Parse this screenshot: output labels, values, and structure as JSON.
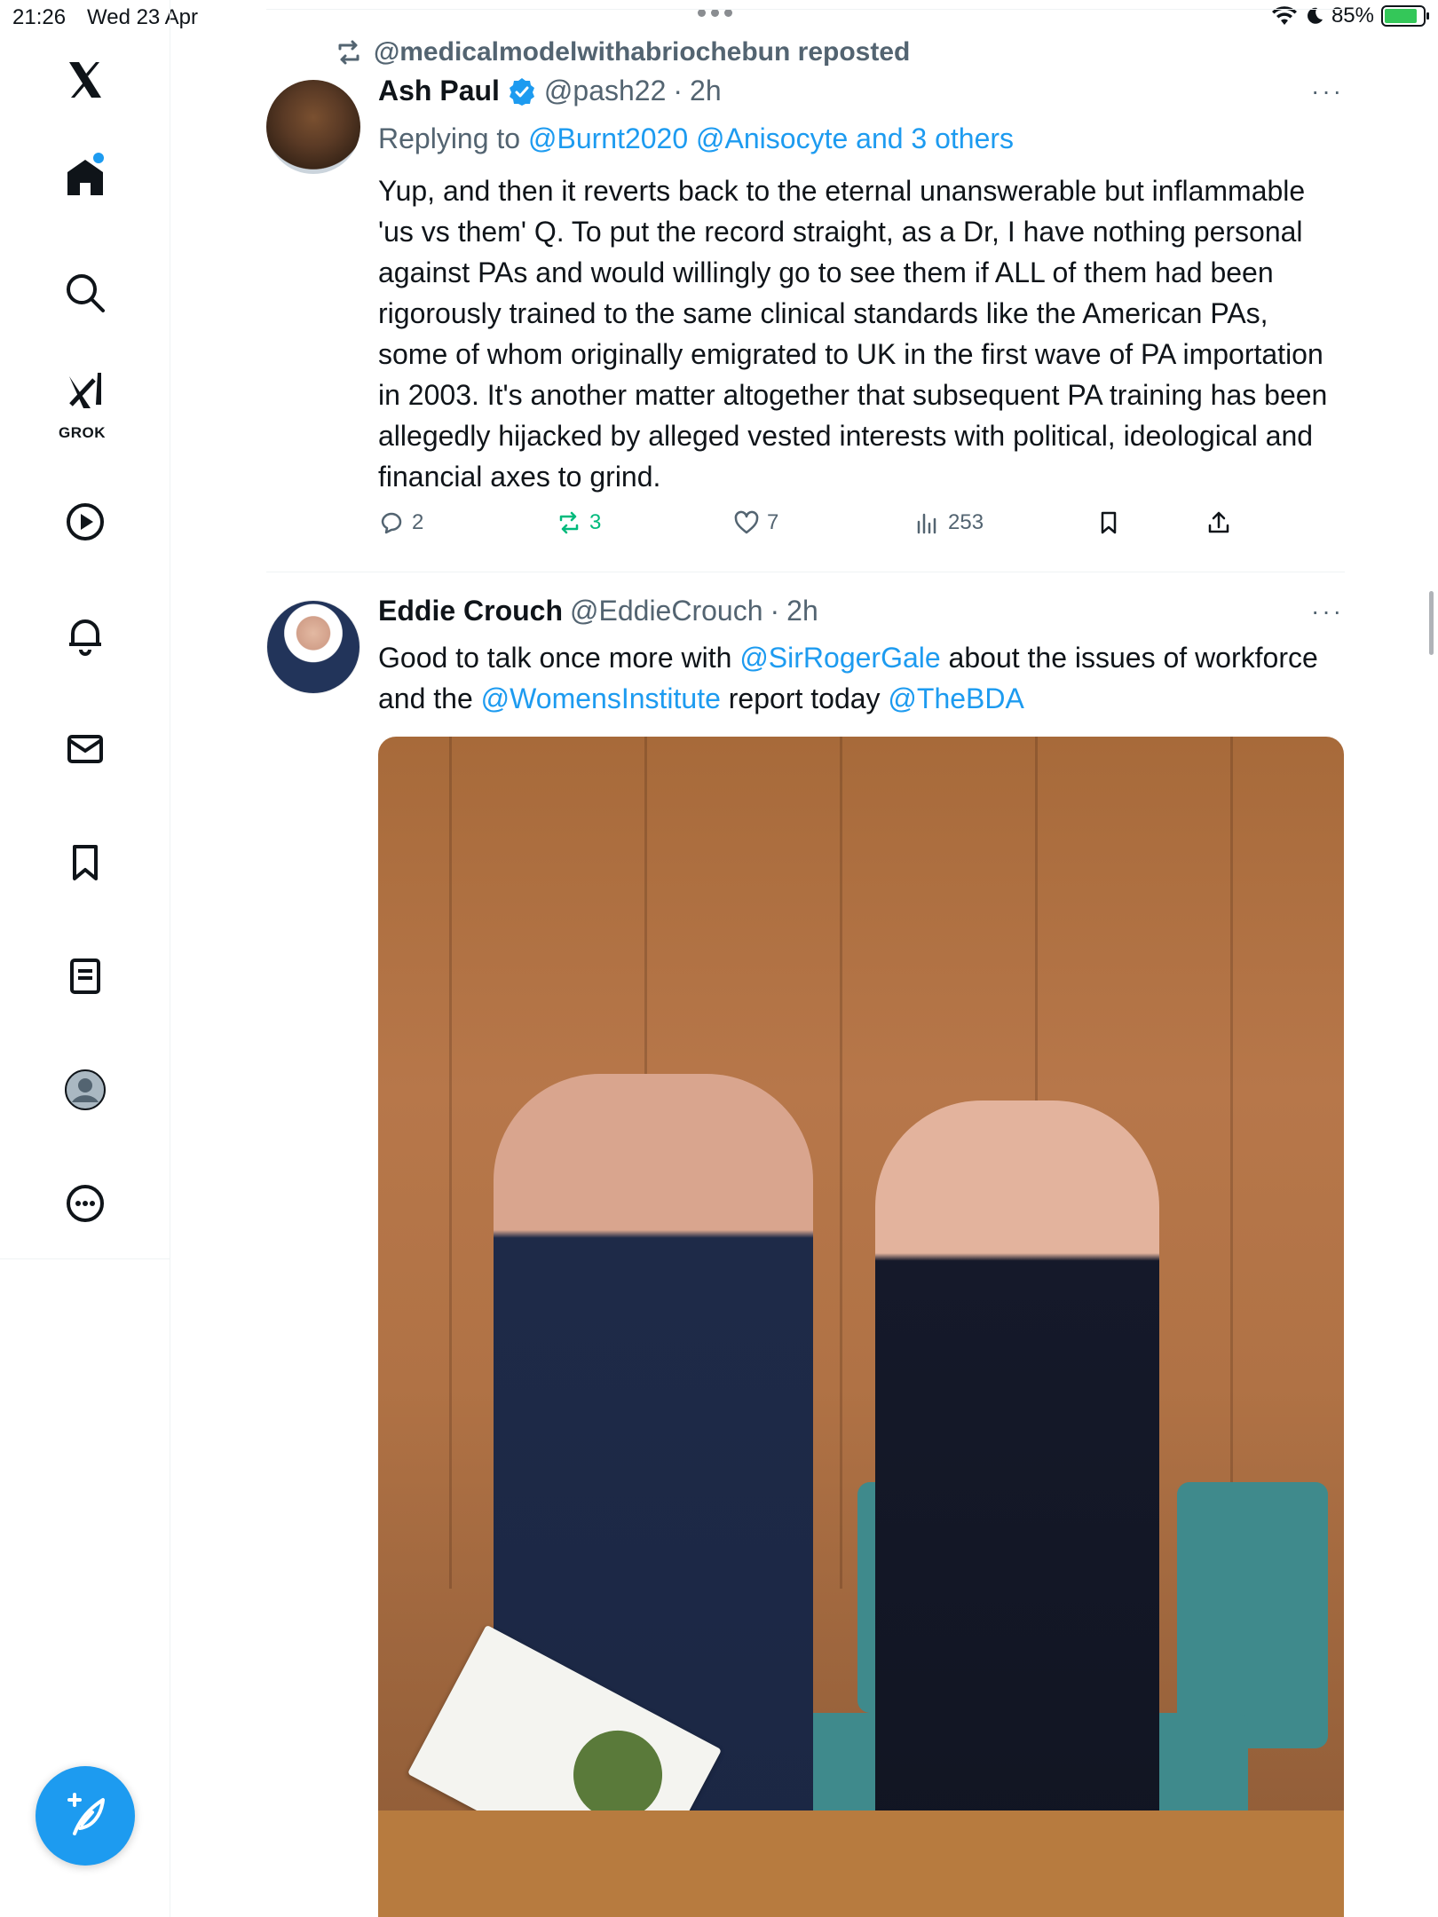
{
  "status_bar": {
    "time": "21:26",
    "date": "Wed 23 Apr",
    "battery_pct": "85%",
    "battery_level": 0.85
  },
  "sidebar": {
    "items": [
      {
        "icon": "x-logo-icon"
      },
      {
        "icon": "home-icon"
      },
      {
        "icon": "search-icon"
      },
      {
        "icon": "grok-icon",
        "label": "GROK"
      },
      {
        "icon": "video-icon"
      },
      {
        "icon": "notifications-icon"
      },
      {
        "icon": "messages-icon"
      },
      {
        "icon": "bookmarks-icon"
      },
      {
        "icon": "lists-icon"
      },
      {
        "icon": "profile-icon"
      },
      {
        "icon": "more-icon"
      }
    ],
    "compose_icon": "compose-post-icon",
    "accent": "#1d9bf0"
  },
  "tweet1": {
    "reposted_by": "@medicalmodelwithabriochebun reposted",
    "name": "Ash Paul",
    "handle": "@pash22",
    "sep": "·",
    "time": "2h",
    "replying_prefix": "Replying to",
    "replying_to": "@Burnt2020 @Anisocyte and 3 others",
    "text": "Yup, and then it reverts back to the eternal unanswerable but inflammable 'us vs them' Q. To put the record straight, as a Dr, I have nothing personal against PAs and would willingly go to see them if ALL of them had been rigorously trained to the same clinical standards like the American PAs, some of whom originally emigrated to UK in the first wave of PA importation in 2003. It's another matter altogether that subsequent PA training has been allegedly hijacked by alleged vested interests with political, ideological and financial axes to grind.",
    "replies": "2",
    "reposts": "3",
    "likes": "7",
    "views": "253",
    "more": "···"
  },
  "tweet2": {
    "name": "Eddie Crouch",
    "handle": "@EddieCrouch",
    "sep": "·",
    "time": "2h",
    "more": "···",
    "text_parts": {
      "a": "Good to talk once more with ",
      "mention1": "@SirRogerGale",
      "b": " about the issues of workforce and the ",
      "mention2": "@WomensInstitute",
      "c": " report today ",
      "mention3": "@TheBDA"
    }
  },
  "colors": {
    "link": "#1d9bf0",
    "repost_green": "#00ba7c",
    "secondary_text": "#536471"
  }
}
